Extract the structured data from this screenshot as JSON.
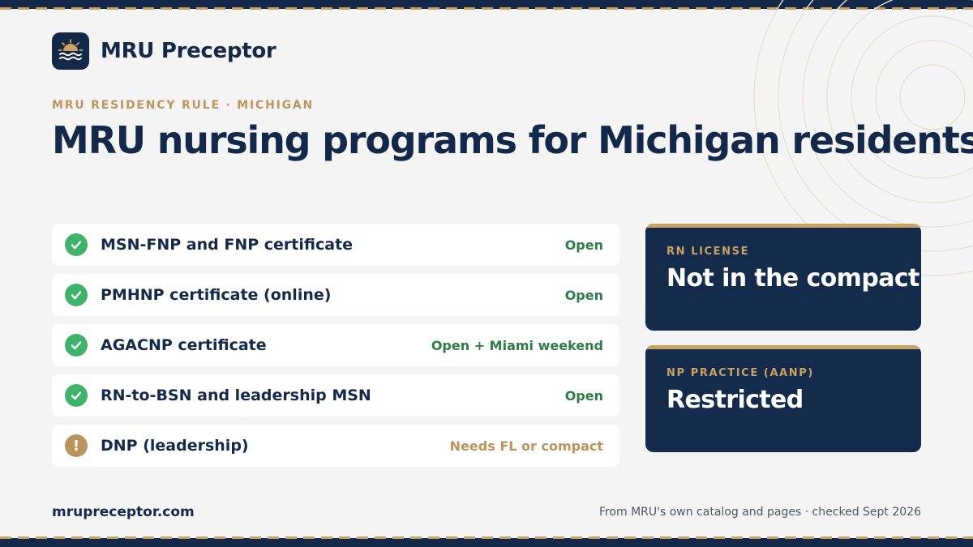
{
  "brand": {
    "name": "MRU Preceptor",
    "logo_icon": "sun-over-waves-icon"
  },
  "eyebrow": "MRU RESIDENCY RULE · MICHIGAN",
  "headline": "MRU nursing programs for Michigan residents",
  "programs": [
    {
      "name": "MSN-FNP and FNP certificate",
      "status": "Open",
      "icon": "check-circle-icon",
      "kind": "open"
    },
    {
      "name": "PMHNP certificate (online)",
      "status": "Open",
      "icon": "check-circle-icon",
      "kind": "open"
    },
    {
      "name": "AGACNP certificate",
      "status": "Open + Miami weekend",
      "icon": "check-circle-icon",
      "kind": "open"
    },
    {
      "name": "RN-to-BSN and leadership MSN",
      "status": "Open",
      "icon": "check-circle-icon",
      "kind": "open"
    },
    {
      "name": "DNP (leadership)",
      "status": "Needs FL or compact",
      "icon": "exclamation-circle-icon",
      "kind": "warn"
    }
  ],
  "cards": [
    {
      "label": "RN LICENSE",
      "value": "Not in the compact"
    },
    {
      "label": "NP PRACTICE (AANP)",
      "value": "Restricted"
    }
  ],
  "footer": {
    "site": "mrupreceptor.com",
    "source": "From MRU's own catalog and pages · checked Sept 2026"
  },
  "colors": {
    "navy": "#14294a",
    "gold": "#c9a263",
    "green": "#3fb36b",
    "warning": "#b9945c",
    "background": "#f4f4f4"
  }
}
